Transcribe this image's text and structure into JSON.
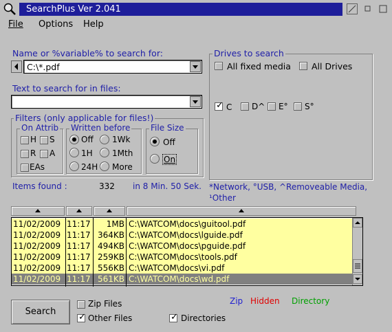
{
  "window": {
    "title": "SearchPlus Ver 2.041"
  },
  "menu": {
    "file": "File",
    "options": "Options",
    "help": "Help"
  },
  "search": {
    "name_label": "Name or %variable% to search for:",
    "name_value": "C:\\*.pdf",
    "text_label": "Text to search for in files:",
    "text_value": ""
  },
  "filters": {
    "title": "Filters (only applicable for files!)",
    "attrib": {
      "title": "On Attrib",
      "items": [
        {
          "label": "H",
          "checked": false
        },
        {
          "label": "S",
          "checked": false
        },
        {
          "label": "R",
          "checked": false
        },
        {
          "label": "A",
          "checked": false
        },
        {
          "label": "EAs",
          "checked": false
        }
      ]
    },
    "written": {
      "title": "Written before",
      "items": [
        {
          "label": "Off",
          "selected": true
        },
        {
          "label": "1Wk",
          "selected": false
        },
        {
          "label": "1H",
          "selected": false
        },
        {
          "label": "1Mth",
          "selected": false
        },
        {
          "label": "24H",
          "selected": false
        },
        {
          "label": "More",
          "selected": false
        }
      ]
    },
    "size": {
      "title": "File Size",
      "items": [
        {
          "label": "Off",
          "selected": true
        },
        {
          "label": "On",
          "selected": false
        }
      ]
    }
  },
  "drives": {
    "title": "Drives to search",
    "all_fixed": "All fixed media",
    "all_drives": "All Drives",
    "items": [
      {
        "label": "C",
        "checked": true
      },
      {
        "label": "D^",
        "checked": false
      },
      {
        "label": "E°",
        "checked": false
      },
      {
        "label": "S°",
        "checked": false
      }
    ],
    "legend_note": "*Network, °USB, ^Removeable Media, ¹Other"
  },
  "status": {
    "items_found_label": "Items found :",
    "items_found_value": "332",
    "time_text": "in 8 Min. 50 Sek."
  },
  "results": {
    "rows": [
      {
        "date": "11/02/2009",
        "time": "11:17",
        "size": "1MB",
        "path": "C:\\WATCOM\\docs\\guitool.pdf",
        "selected": false
      },
      {
        "date": "11/02/2009",
        "time": "11:17",
        "size": "364KB",
        "path": "C:\\WATCOM\\docs\\lguide.pdf",
        "selected": false
      },
      {
        "date": "11/02/2009",
        "time": "11:17",
        "size": "494KB",
        "path": "C:\\WATCOM\\docs\\pguide.pdf",
        "selected": false
      },
      {
        "date": "11/02/2009",
        "time": "11:17",
        "size": "259KB",
        "path": "C:\\WATCOM\\docs\\tools.pdf",
        "selected": false
      },
      {
        "date": "11/02/2009",
        "time": "11:17",
        "size": "556KB",
        "path": "C:\\WATCOM\\docs\\vi.pdf",
        "selected": false
      },
      {
        "date": "11/02/2009",
        "time": "11:17",
        "size": "561KB",
        "path": "C:\\WATCOM\\docs\\wd.pdf",
        "selected": true
      }
    ]
  },
  "bottom": {
    "search_button": "Search",
    "zip_files": "Zip Files",
    "other_files": "Other Files",
    "directories": "Directories",
    "legend_zip": "Zip",
    "legend_hidden": "Hidden",
    "legend_directory": "Directory"
  },
  "colors": {
    "title_bar": "#1e1e9a",
    "row_bg": "#ffffa0",
    "selected_row_bg": "#808080",
    "label_blue": "#2020a8",
    "zip": "#2020d0",
    "hidden": "#e00000",
    "directory": "#00a000"
  }
}
